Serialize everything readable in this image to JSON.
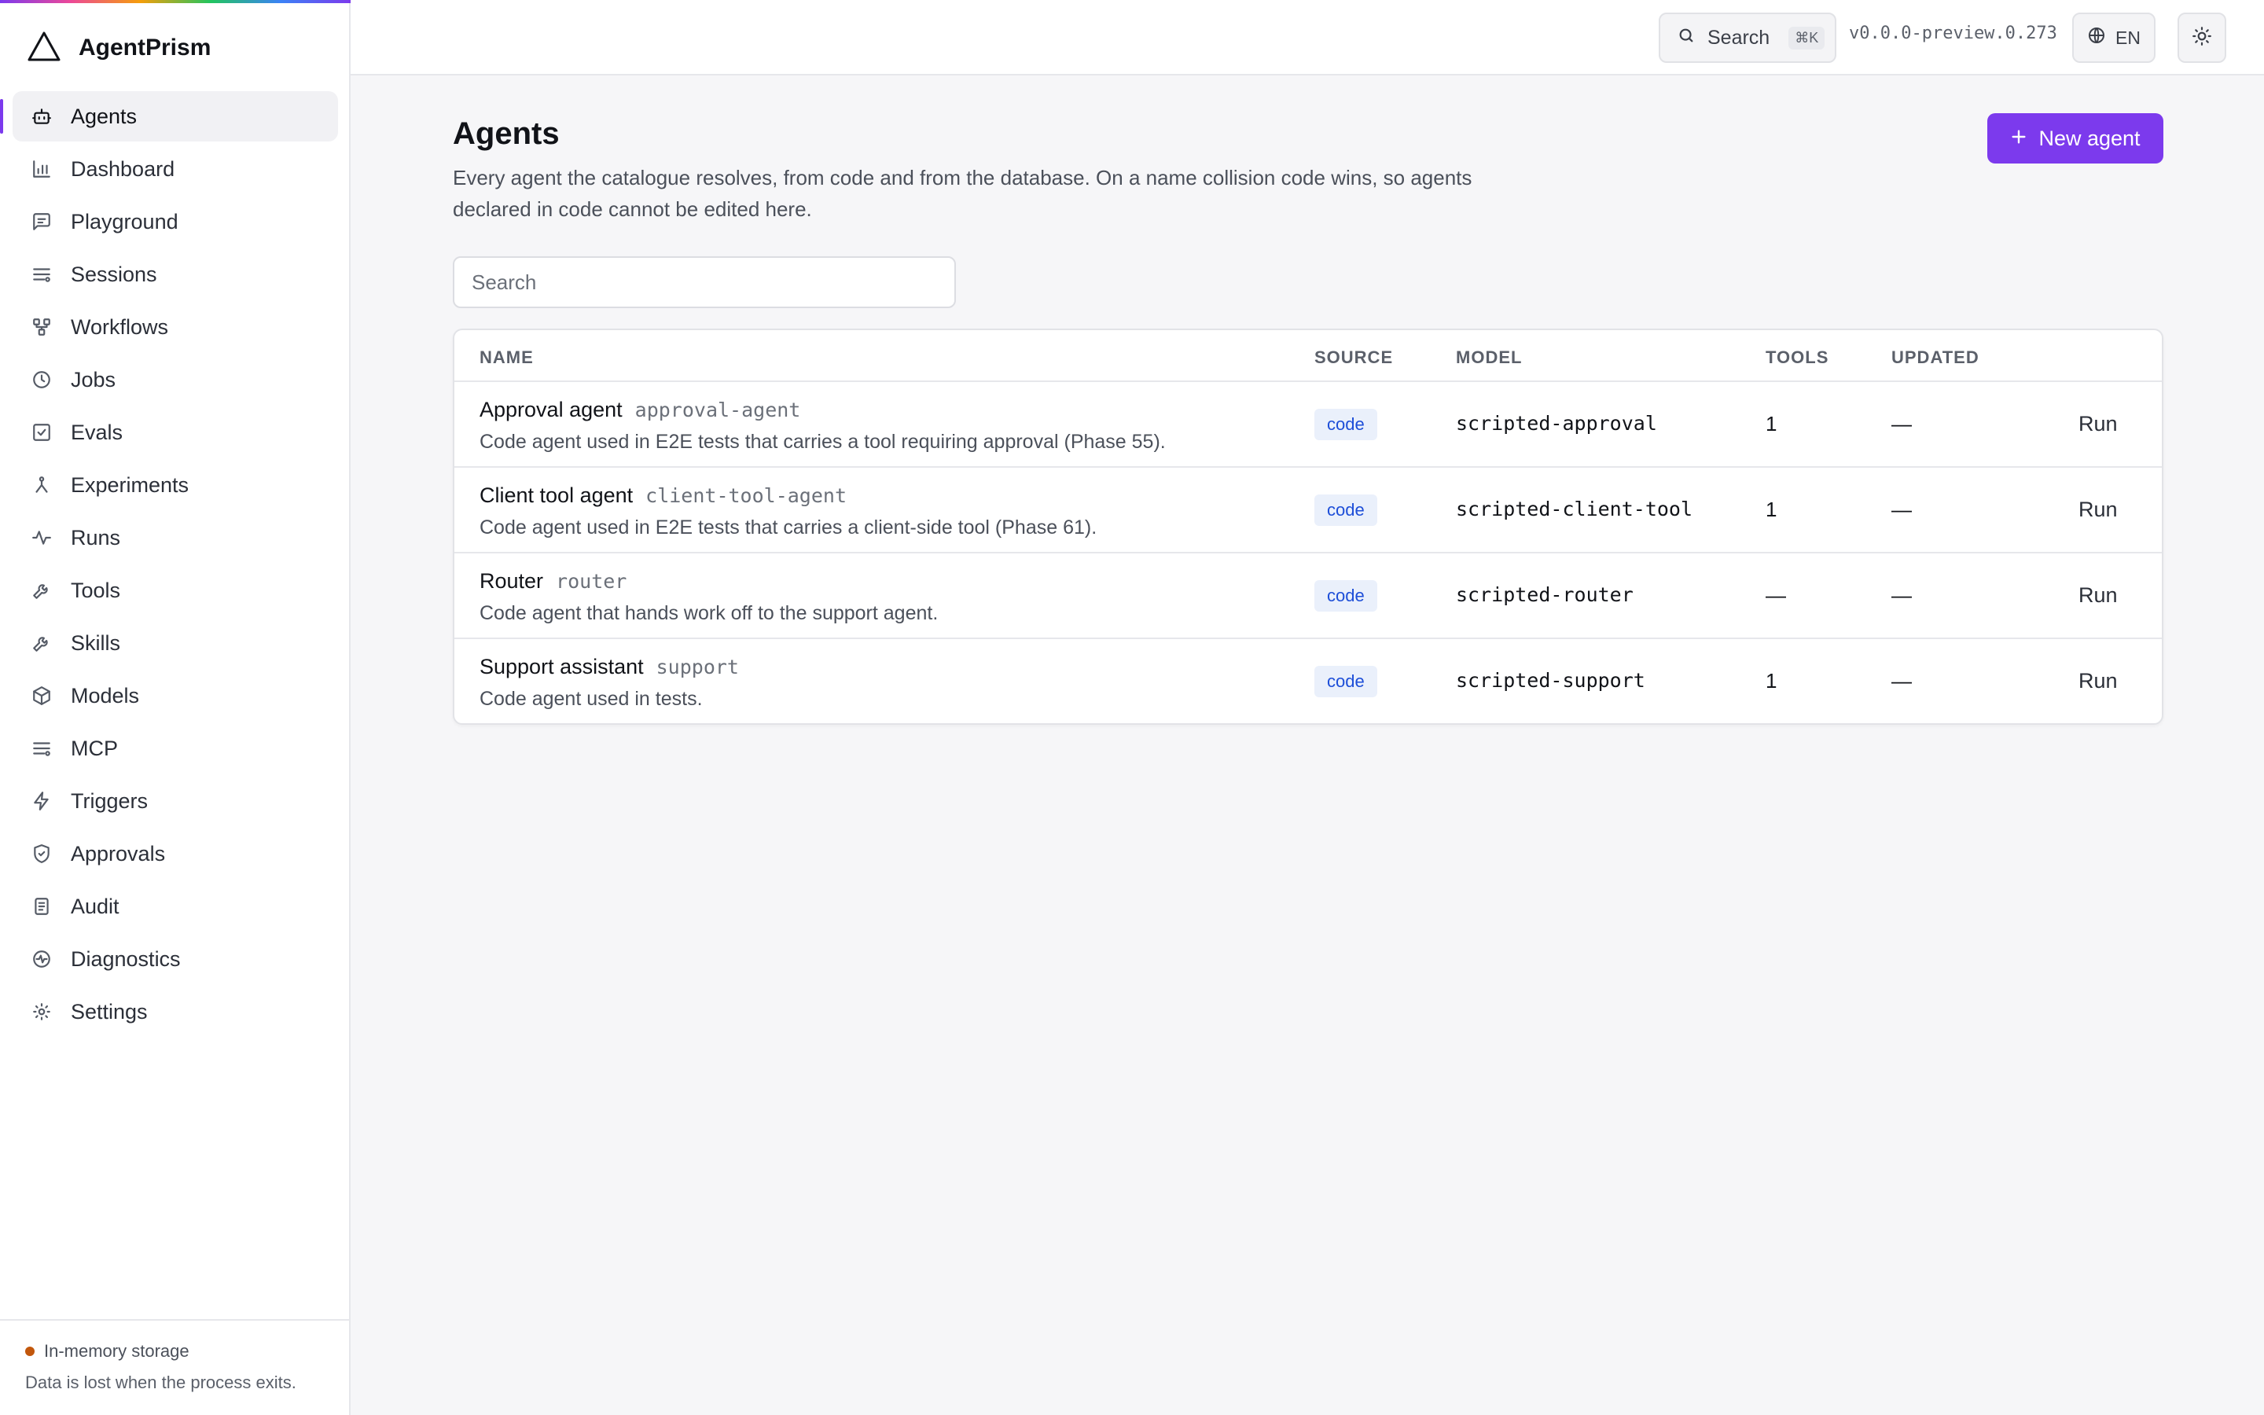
{
  "app": {
    "name": "AgentPrism",
    "version": "v0.0.0-preview.0.273",
    "language": "EN"
  },
  "topbar": {
    "search_label": "Search",
    "search_shortcut": "⌘K"
  },
  "sidebar": {
    "items": [
      {
        "label": "Agents",
        "icon": "bot-icon",
        "active": true
      },
      {
        "label": "Dashboard",
        "icon": "bar-chart-icon"
      },
      {
        "label": "Playground",
        "icon": "message-square-icon"
      },
      {
        "label": "Sessions",
        "icon": "list-icon"
      },
      {
        "label": "Workflows",
        "icon": "workflow-icon"
      },
      {
        "label": "Jobs",
        "icon": "clock-icon"
      },
      {
        "label": "Evals",
        "icon": "check-square-icon"
      },
      {
        "label": "Experiments",
        "icon": "flask-icon"
      },
      {
        "label": "Runs",
        "icon": "activity-icon"
      },
      {
        "label": "Tools",
        "icon": "wrench-icon"
      },
      {
        "label": "Skills",
        "icon": "wrench-icon"
      },
      {
        "label": "Models",
        "icon": "box-icon"
      },
      {
        "label": "MCP",
        "icon": "list-icon"
      },
      {
        "label": "Triggers",
        "icon": "zap-icon"
      },
      {
        "label": "Approvals",
        "icon": "shield-check-icon"
      },
      {
        "label": "Audit",
        "icon": "clipboard-icon"
      },
      {
        "label": "Diagnostics",
        "icon": "pulse-icon"
      },
      {
        "label": "Settings",
        "icon": "sun-gear-icon"
      }
    ],
    "storage_title": "In-memory storage",
    "storage_subtitle": "Data is lost when the process exits.",
    "storage_color": "#c2570c"
  },
  "main": {
    "title": "Agents",
    "description": "Every agent the catalogue resolves, from code and from the database. On a name collision code wins, so agents declared in code cannot be edited here.",
    "new_button": "New agent",
    "search_placeholder": "Search",
    "accent": "#7c3aed"
  },
  "table": {
    "headers": [
      "NAME",
      "SOURCE",
      "MODEL",
      "TOOLS",
      "UPDATED"
    ],
    "rows": [
      {
        "name": "Approval agent",
        "slug": "approval-agent",
        "description": "Code agent used in E2E tests that carries a tool requiring approval (Phase 55).",
        "source": "code",
        "model": "scripted-approval",
        "tools": "1",
        "updated": "—",
        "action": "Run"
      },
      {
        "name": "Client tool agent",
        "slug": "client-tool-agent",
        "description": "Code agent used in E2E tests that carries a client-side tool (Phase 61).",
        "source": "code",
        "model": "scripted-client-tool",
        "tools": "1",
        "updated": "—",
        "action": "Run"
      },
      {
        "name": "Router",
        "slug": "router",
        "description": "Code agent that hands work off to the support agent.",
        "source": "code",
        "model": "scripted-router",
        "tools": "—",
        "updated": "—",
        "action": "Run"
      },
      {
        "name": "Support assistant",
        "slug": "support",
        "description": "Code agent used in tests.",
        "source": "code",
        "model": "scripted-support",
        "tools": "1",
        "updated": "—",
        "action": "Run"
      }
    ]
  }
}
